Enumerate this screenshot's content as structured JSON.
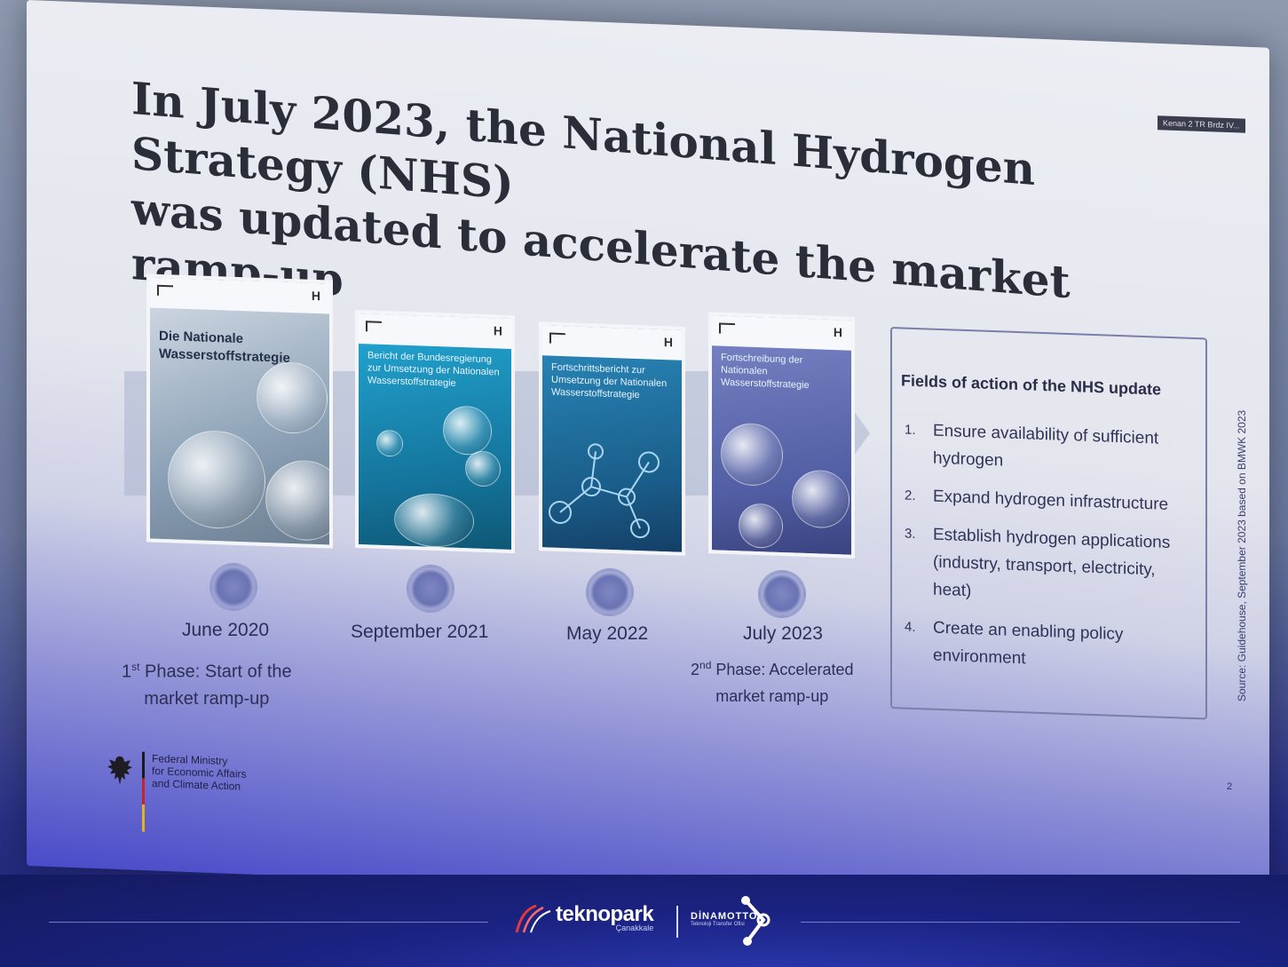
{
  "screen_label": "Kenan 2 TR Brdz IV...",
  "title": {
    "line1": "In July 2023, the National Hydrogen Strategy (NHS)",
    "line2": "was updated to accelerate the market ramp-up"
  },
  "covers": [
    {
      "title": "Die Nationale Wasserstoffstrategie",
      "logo": "H"
    },
    {
      "title": "Bericht der Bundesregierung zur Umsetzung der Nationalen Wasserstoffstrategie",
      "logo": "H"
    },
    {
      "title": "Fortschrittsbericht zur Umsetzung der Nationalen Wasserstoffstrategie",
      "logo": "H"
    },
    {
      "title": "Fortschreibung der Nationalen Wasserstoffstrategie",
      "logo": "H"
    }
  ],
  "timeline": [
    {
      "date": "June 2020",
      "phase_num": "1",
      "phase_sup": "st",
      "phase_line1": " Phase: Start of the",
      "phase_line2": "market ramp-up"
    },
    {
      "date": "September 2021"
    },
    {
      "date": "May 2022"
    },
    {
      "date": "July 2023",
      "phase_num": "2",
      "phase_sup": "nd",
      "phase_line1": " Phase: Accelerated",
      "phase_line2": "market ramp-up"
    }
  ],
  "fields": {
    "title": "Fields of action of the NHS update",
    "items": [
      {
        "num": "1.",
        "text": "Ensure availability of sufficient hydrogen"
      },
      {
        "num": "2.",
        "text": "Expand hydrogen infrastructure"
      },
      {
        "num": "3.",
        "text": "Establish hydrogen applications (industry, transport, electricity, heat)"
      },
      {
        "num": "4.",
        "text": "Create an enabling policy environment"
      }
    ]
  },
  "source": "Source: Guidehouse, September 2023 based on BMWK 2023",
  "page_number": "2",
  "ministry": "Federal Ministry\nfor Economic Affairs\nand Climate Action",
  "branding": {
    "teknopark": "teknopark",
    "teknopark_sub": "Çanakkale",
    "dinamotto": "DİNAMOTTO",
    "dinamotto_sub": "Teknoloji Transfer Ofisi"
  },
  "colors": {
    "accent": "#1b2383",
    "slide_text": "#2c2f55"
  }
}
